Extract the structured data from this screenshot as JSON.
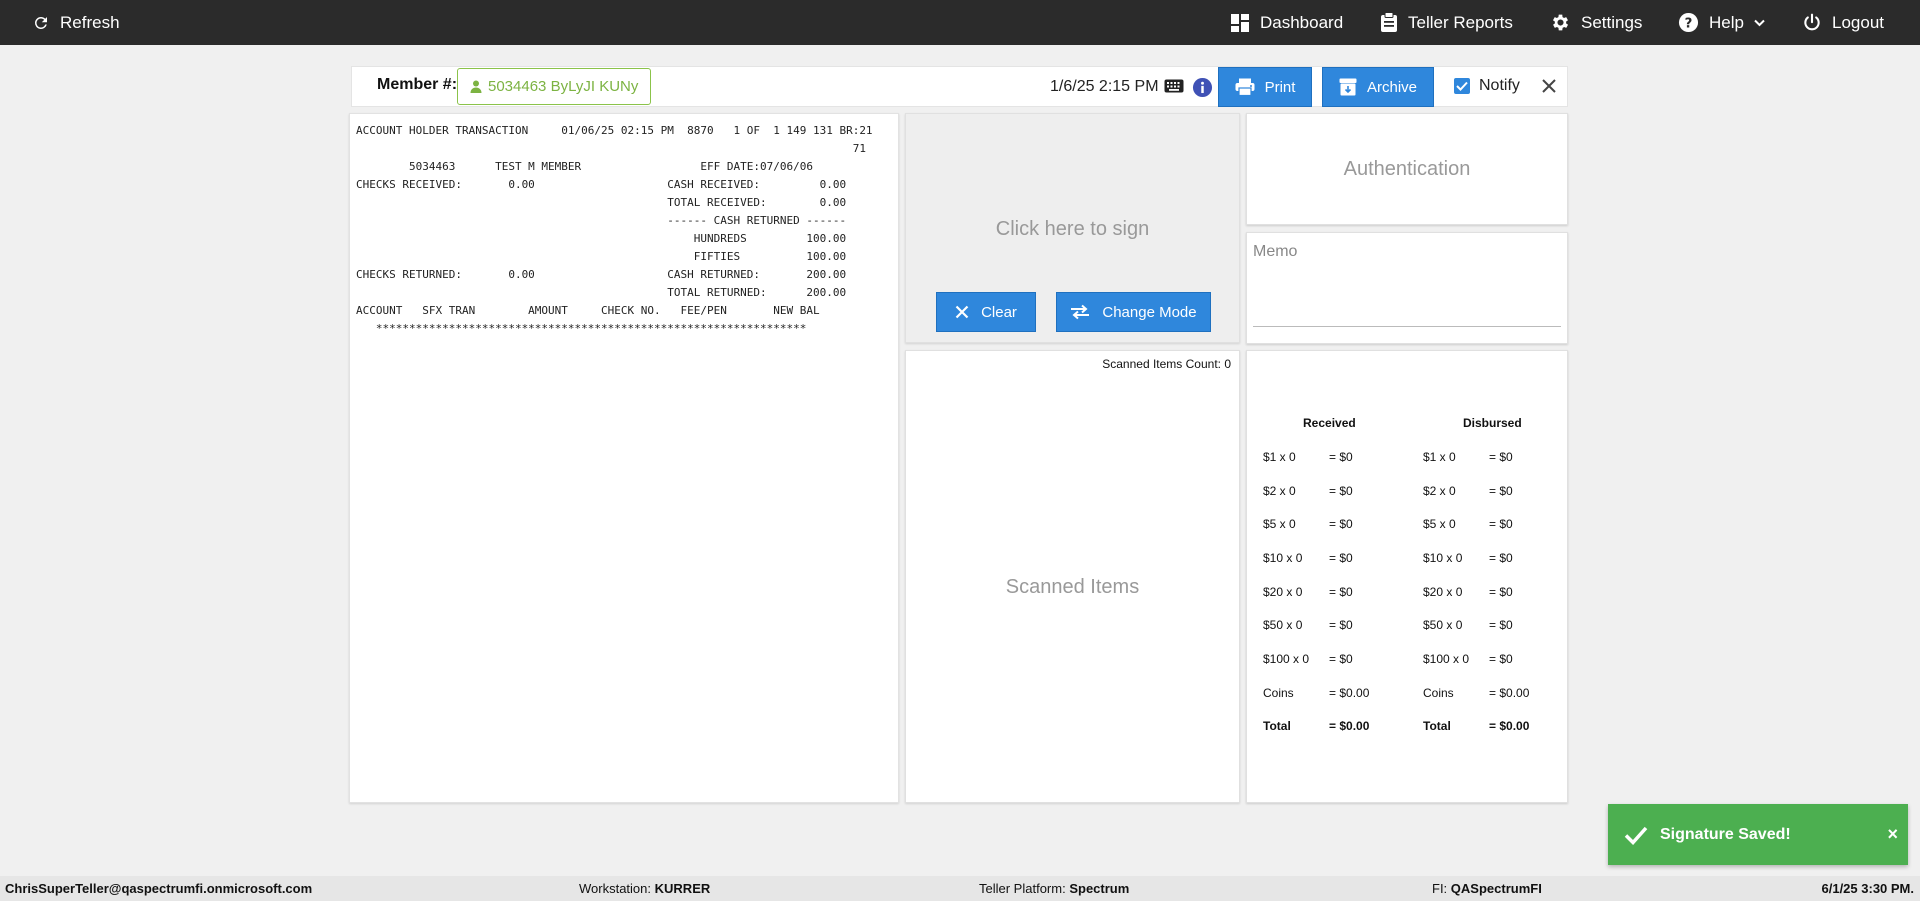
{
  "nav": {
    "refresh": "Refresh",
    "dashboard": "Dashboard",
    "teller_reports": "Teller Reports",
    "settings": "Settings",
    "help": "Help",
    "logout": "Logout"
  },
  "header": {
    "member_label": "Member #:",
    "member_value": "5034463 ByLyJI KUNy",
    "datetime": "1/6/25 2:15 PM",
    "print": "Print",
    "archive": "Archive",
    "notify": "Notify",
    "notify_checked": true
  },
  "receipt": {
    "lines": [
      "ACCOUNT HOLDER TRANSACTION     01/06/25 02:15 PM  8870   1 OF  1 149 131 BR:21",
      "                                                                           71",
      "        5034463      TEST M MEMBER                  EFF DATE:07/06/06",
      "CHECKS RECEIVED:       0.00                    CASH RECEIVED:         0.00",
      "                                               TOTAL RECEIVED:        0.00",
      "                                               ------ CASH RETURNED ------",
      "                                                   HUNDREDS         100.00",
      "                                                   FIFTIES          100.00",
      "CHECKS RETURNED:       0.00                    CASH RETURNED:       200.00",
      "                                               TOTAL RETURNED:      200.00",
      "ACCOUNT   SFX TRAN        AMOUNT     CHECK NO.   FEE/PEN       NEW BAL",
      "   *****************************************************************"
    ]
  },
  "signature": {
    "prompt": "Click here to sign",
    "clear": "Clear",
    "change_mode": "Change Mode"
  },
  "scanned": {
    "count_label": "Scanned Items Count: 0",
    "placeholder": "Scanned Items"
  },
  "authentication": {
    "label": "Authentication"
  },
  "memo": {
    "placeholder": "Memo"
  },
  "cash": {
    "received": {
      "heading": "Received",
      "rows": [
        {
          "denom": "$1 x 0",
          "amount": "= $0"
        },
        {
          "denom": "$2 x 0",
          "amount": "= $0"
        },
        {
          "denom": "$5 x 0",
          "amount": "= $0"
        },
        {
          "denom": "$10 x 0",
          "amount": "= $0"
        },
        {
          "denom": "$20 x 0",
          "amount": "= $0"
        },
        {
          "denom": "$50 x 0",
          "amount": "= $0"
        },
        {
          "denom": "$100 x 0",
          "amount": "= $0"
        },
        {
          "denom": "Coins",
          "amount": "= $0.00"
        },
        {
          "denom": "Total",
          "amount": "= $0.00"
        }
      ]
    },
    "disbursed": {
      "heading": "Disbursed",
      "rows": [
        {
          "denom": "$1 x 0",
          "amount": "= $0"
        },
        {
          "denom": "$2 x 0",
          "amount": "= $0"
        },
        {
          "denom": "$5 x 0",
          "amount": "= $0"
        },
        {
          "denom": "$10 x 0",
          "amount": "= $0"
        },
        {
          "denom": "$20 x 0",
          "amount": "= $0"
        },
        {
          "denom": "$50 x 0",
          "amount": "= $0"
        },
        {
          "denom": "$100 x 0",
          "amount": "= $0"
        },
        {
          "denom": "Coins",
          "amount": "= $0.00"
        },
        {
          "denom": "Total",
          "amount": "= $0.00"
        }
      ]
    }
  },
  "toast": {
    "message": "Signature Saved!",
    "close": "×"
  },
  "status": {
    "user": "ChrisSuperTeller@qaspectrumfi.onmicrosoft.com",
    "workstation_label": "Workstation:",
    "workstation": "KURRER",
    "platform_label": "Teller Platform:",
    "platform": "Spectrum",
    "fi_label": "FI:",
    "fi": "QASpectrumFI",
    "datetime": "6/1/25 3:30 PM."
  },
  "colors": {
    "nav_bg": "#2b2b2b",
    "primary": "#2f87dc",
    "member_green": "#7cb342",
    "toast_green": "#4caf50",
    "info_icon": "#3f51b5"
  }
}
